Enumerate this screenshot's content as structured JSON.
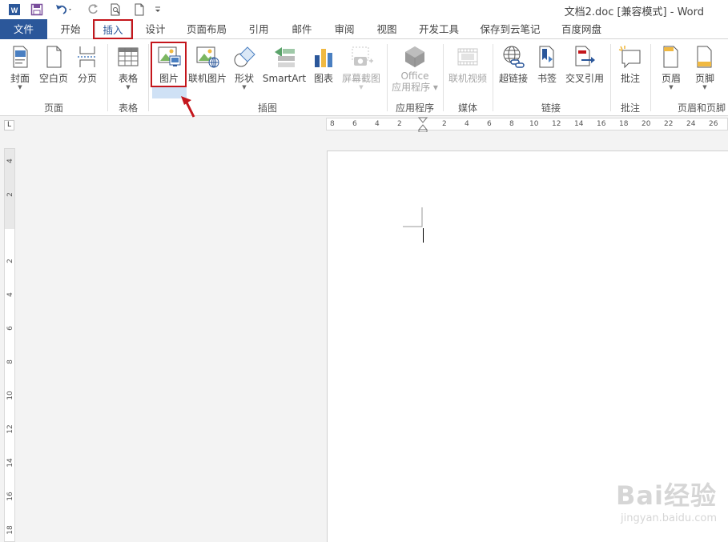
{
  "title": "文档2.doc [兼容模式] - Word",
  "tabs": [
    {
      "label": "文件"
    },
    {
      "label": "开始"
    },
    {
      "label": "插入"
    },
    {
      "label": "设计"
    },
    {
      "label": "页面布局"
    },
    {
      "label": "引用"
    },
    {
      "label": "邮件"
    },
    {
      "label": "审阅"
    },
    {
      "label": "视图"
    },
    {
      "label": "开发工具"
    },
    {
      "label": "保存到云笔记"
    },
    {
      "label": "百度网盘"
    }
  ],
  "active_tab": "插入",
  "ribbon": {
    "groups": [
      {
        "label": "页面"
      },
      {
        "label": "表格"
      },
      {
        "label": "插图"
      },
      {
        "label": "应用程序"
      },
      {
        "label": "媒体"
      },
      {
        "label": "链接"
      },
      {
        "label": "批注"
      },
      {
        "label": "页眉和页脚"
      }
    ],
    "buttons": [
      {
        "label": "封面",
        "icon": "cover-page-icon",
        "dropdown": true
      },
      {
        "label": "空白页",
        "icon": "blank-page-icon"
      },
      {
        "label": "分页",
        "icon": "page-break-icon"
      },
      {
        "label": "表格",
        "icon": "table-icon",
        "dropdown": true
      },
      {
        "label": "图片",
        "icon": "picture-icon"
      },
      {
        "label": "联机图片",
        "icon": "online-picture-icon"
      },
      {
        "label": "形状",
        "icon": "shapes-icon",
        "dropdown": true
      },
      {
        "label": "SmartArt",
        "icon": "smartart-icon"
      },
      {
        "label": "图表",
        "icon": "chart-icon"
      },
      {
        "label": "屏幕截图",
        "icon": "screenshot-icon",
        "dropdown": true,
        "disabled": true
      },
      {
        "label": "Office",
        "label2": "应用程序",
        "icon": "office-apps-icon",
        "dropdown": true,
        "disabled": true
      },
      {
        "label": "联机视频",
        "icon": "online-video-icon",
        "disabled": true
      },
      {
        "label": "超链接",
        "icon": "hyperlink-icon"
      },
      {
        "label": "书签",
        "icon": "bookmark-icon"
      },
      {
        "label": "交叉引用",
        "icon": "cross-reference-icon"
      },
      {
        "label": "批注",
        "icon": "comment-icon"
      },
      {
        "label": "页眉",
        "icon": "header-icon",
        "dropdown": true
      },
      {
        "label": "页脚",
        "icon": "footer-icon",
        "dropdown": true
      }
    ]
  },
  "horizontal_ruler": {
    "ticks": [
      "8",
      "6",
      "4",
      "2",
      "2",
      "4",
      "6",
      "8",
      "10",
      "12",
      "14",
      "16",
      "18",
      "20",
      "22",
      "24",
      "26"
    ]
  },
  "vertical_ruler": {
    "ticks": [
      "4",
      "2",
      "2",
      "4",
      "6",
      "8",
      "10",
      "12",
      "14",
      "16",
      "18"
    ]
  },
  "watermark": {
    "brand": "Bai经验",
    "url": "jingyan.baidu.com"
  },
  "colors": {
    "accent": "#2b579a",
    "highlight": "#c4161c",
    "file_tab": "#2b579a"
  }
}
